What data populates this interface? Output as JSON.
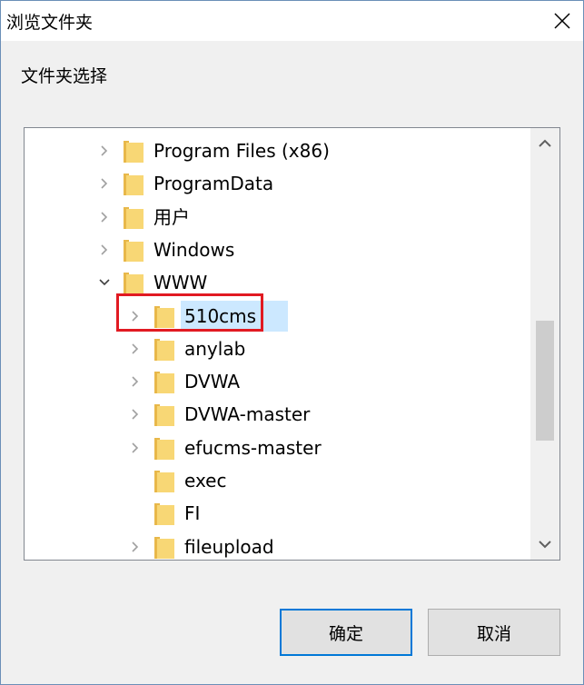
{
  "window": {
    "title": "浏览文件夹",
    "close_icon": "close-icon"
  },
  "instruction": "文件夹选择",
  "tree": {
    "items": [
      {
        "label": "Program Files (x86)",
        "expander": "right",
        "level": 0
      },
      {
        "label": "ProgramData",
        "expander": "right",
        "level": 0
      },
      {
        "label": "用户",
        "expander": "right",
        "level": 0
      },
      {
        "label": "Windows",
        "expander": "right",
        "level": 0
      },
      {
        "label": "WWW",
        "expander": "down",
        "level": 0
      },
      {
        "label": "510cms",
        "expander": "right",
        "level": 1,
        "selected": true
      },
      {
        "label": "anylab",
        "expander": "right",
        "level": 1
      },
      {
        "label": "DVWA",
        "expander": "right",
        "level": 1
      },
      {
        "label": "DVWA-master",
        "expander": "right",
        "level": 1
      },
      {
        "label": "efucms-master",
        "expander": "right",
        "level": 1
      },
      {
        "label": "exec",
        "expander": "none",
        "level": 1
      },
      {
        "label": "FI",
        "expander": "none",
        "level": 1
      },
      {
        "label": "fileupload",
        "expander": "right",
        "level": 1
      }
    ]
  },
  "buttons": {
    "ok_label": "确定",
    "cancel_label": "取消"
  },
  "colors": {
    "selection": "#cce8ff",
    "annotation_border": "#e11a22",
    "folder": "#f8d775",
    "default_button_border": "#0078d7"
  }
}
